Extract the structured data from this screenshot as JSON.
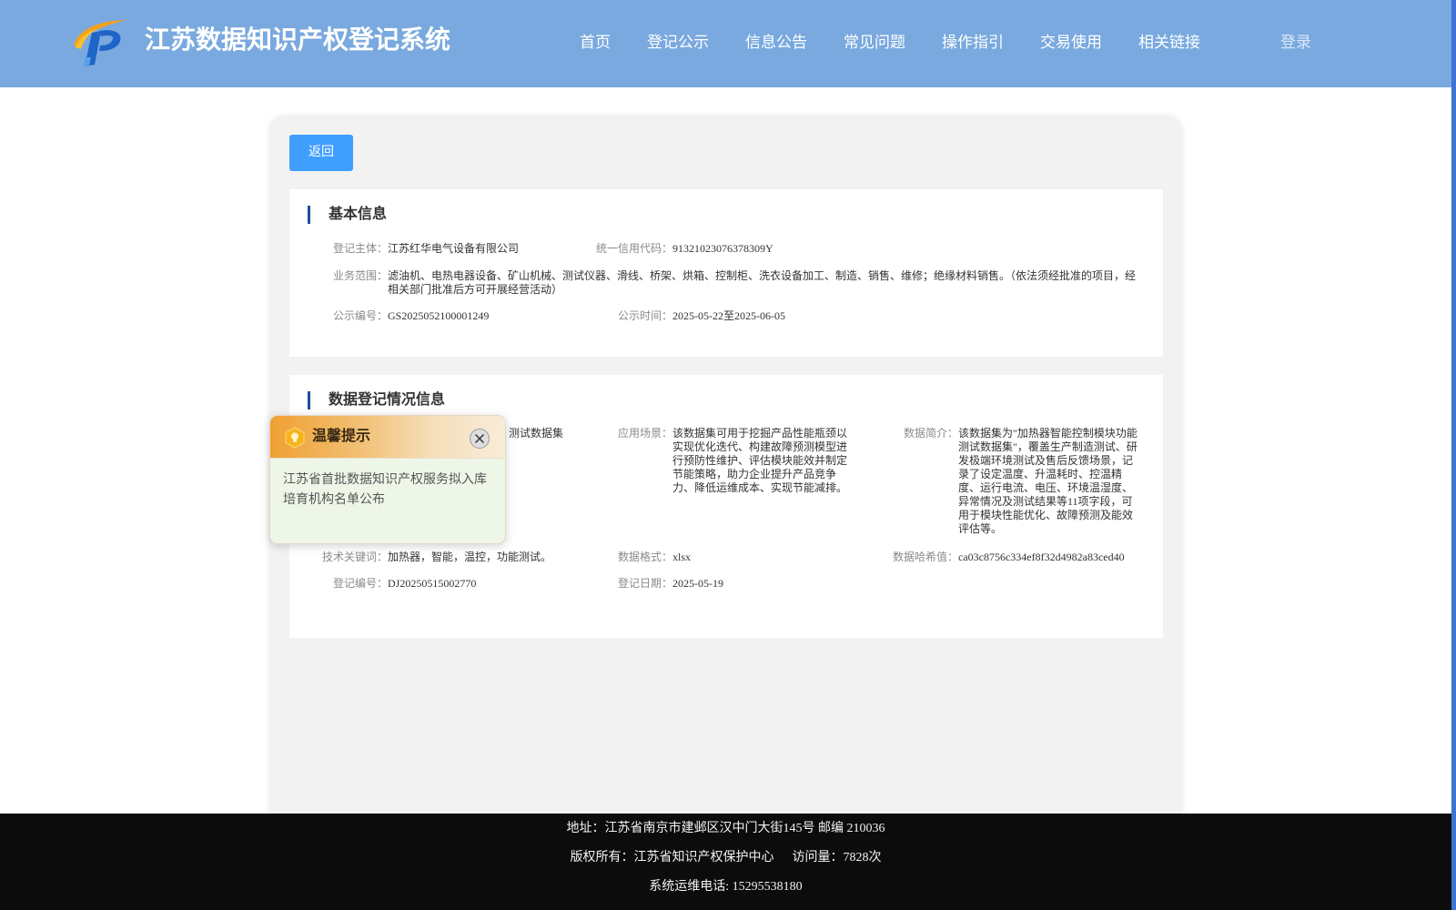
{
  "colors": {
    "header_bg": "#79a9df",
    "primary_button": "#409eff",
    "section_bar": "#1b4f9c",
    "footer_bg": "#0c0c0c",
    "edge_bar": "#3f74d4"
  },
  "header": {
    "logo_icon": "system-logo-icon",
    "title": "江苏数据知识产权登记系统",
    "nav": [
      {
        "label": "首页"
      },
      {
        "label": "登记公示"
      },
      {
        "label": "信息公告"
      },
      {
        "label": "常见问题"
      },
      {
        "label": "操作指引"
      },
      {
        "label": "交易使用"
      },
      {
        "label": "相关链接"
      }
    ],
    "login_label": "登录"
  },
  "toolbar": {
    "back_label": "返回"
  },
  "basic_info": {
    "title": "基本信息",
    "subject": {
      "label": "登记主体：",
      "value": "江苏红华电气设备有限公司"
    },
    "credit_code": {
      "label": "统一信用代码：",
      "value": "91321023076378309Y"
    },
    "business_scope": {
      "label": "业务范围：",
      "value": "滤油机、电热电器设备、矿山机械、测试仪器、滑线、桥架、烘箱、控制柜、洗衣设备加工、制造、销售、维修；绝缘材料销售。（依法须经批准的项目，经相关部门批准后方可开展经营活动）"
    },
    "notice_no": {
      "label": "公示编号：",
      "value": "GS2025052100001249"
    },
    "notice_period": {
      "label": "公示时间：",
      "value": "2025-05-22至2025-06-05"
    }
  },
  "data_info": {
    "title": "数据登记情况信息",
    "data_name_visible_part": "测试数据集",
    "application_scene": {
      "label": "应用场景：",
      "value": "该数据集可用于挖掘产品性能瓶颈以实现优化迭代、构建故障预测模型进行预防性维护、评估模块能效并制定节能策略，助力企业提升产品竞争力、降低运维成本、实现节能减排。"
    },
    "data_intro": {
      "label": "数据简介：",
      "value": "该数据集为\"加热器智能控制模块功能测试数据集\"，覆盖生产制造测试、研发极端环境测试及售后反馈场景，记录了设定温度、升温耗时、控温精度、运行电流、电压、环境温湿度、异常情况及测试结果等11项字段，可用于模块性能优化、故障预测及能效评估等。"
    },
    "tech_keywords": {
      "label": "技术关键词：",
      "value": "加热器，智能，温控，功能测试。"
    },
    "data_format": {
      "label": "数据格式：",
      "value": "xlsx"
    },
    "data_hash": {
      "label": "数据哈希值：",
      "value": "ca03c8756c334ef8f32d4982a83ced40"
    },
    "reg_no": {
      "label": "登记编号：",
      "value": "DJ20250515002770"
    },
    "reg_date": {
      "label": "登记日期：",
      "value": "2025-05-19"
    }
  },
  "notice_popup": {
    "icon": "lightbulb-icon",
    "title": "温馨提示",
    "close_icon": "close-icon",
    "message": "江苏省首批数据知识产权服务拟入库培育机构名单公布"
  },
  "footer": {
    "address": "地址：江苏省南京市建邺区汉中门大街145号 邮编 210036",
    "copyright": "版权所有：江苏省知识产权保护中心",
    "visits": "访问量：7828次",
    "phone": "系统运维电话: 15295538180"
  }
}
